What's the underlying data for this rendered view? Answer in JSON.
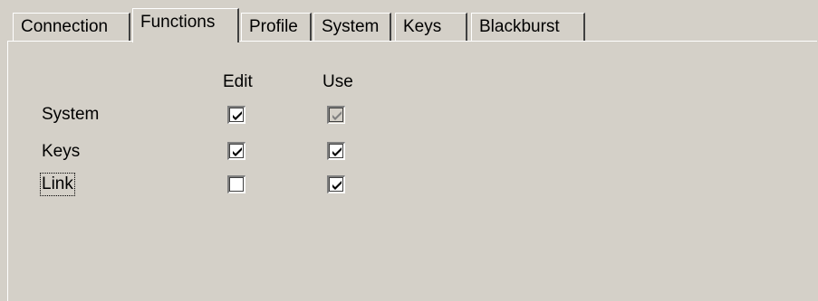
{
  "tabs": [
    {
      "label": "Connection",
      "active": false
    },
    {
      "label": "Functions",
      "active": true
    },
    {
      "label": "Profile",
      "active": false
    },
    {
      "label": "System",
      "active": false
    },
    {
      "label": "Keys",
      "active": false
    },
    {
      "label": "Blackburst",
      "active": false
    }
  ],
  "columns": {
    "edit": "Edit",
    "use": "Use"
  },
  "rows": [
    {
      "label": "System",
      "edit": true,
      "use": true,
      "use_enabled": false
    },
    {
      "label": "Keys",
      "edit": true,
      "use": true,
      "use_enabled": true
    },
    {
      "label": "Link",
      "edit": false,
      "use": true,
      "use_enabled": true
    }
  ],
  "colors": {
    "background": "#d4d0c8",
    "check": "#000000",
    "check_disabled": "#808080"
  }
}
